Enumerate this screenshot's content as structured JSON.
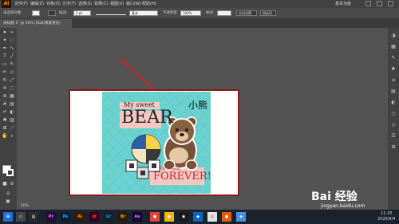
{
  "app": {
    "logo": "Ai"
  },
  "menu": [
    "文件(F)",
    "编辑(E)",
    "对象(O)",
    "文字(T)",
    "选择(S)",
    "效果(C)",
    "视图(V)",
    "窗口(W)",
    "帮助(H)"
  ],
  "workspace": {
    "label": "基本功能"
  },
  "control_bar": {
    "selection_label": "未选择对象",
    "stroke_label": "描边:",
    "stroke_width": "1 pt",
    "brush_label": "基本",
    "opacity_label": "不透明度",
    "opacity_value": "100%",
    "style_label": "样式:",
    "doc_setup_label": "文档设置",
    "prefs_label": "首选项"
  },
  "document_tab": {
    "title": "未标题-1* @ 50% (RGB/像素预览)"
  },
  "artwork": {
    "title_top": "My sweet",
    "title_main": "BEAR",
    "subtitle_cn": "小熊",
    "caption_top": "My Friend",
    "caption_main": "FOREVER!"
  },
  "status": {
    "zoom": "50%"
  },
  "taskbar": {
    "apps": [
      "Pr",
      "Ps",
      "Ai",
      "Id",
      "Lr",
      "Br",
      "Ae"
    ],
    "time": "11:20",
    "date": "2020/4/4"
  },
  "watermark": {
    "brand": "Bai 经验",
    "url": "jingyan.baidu.com"
  },
  "colors": {
    "artboard_border": "#8b1a1a",
    "art_background": "#6cd2cf",
    "annotation_arrow": "#c0282d",
    "ai_orange": "#ff9a00"
  }
}
